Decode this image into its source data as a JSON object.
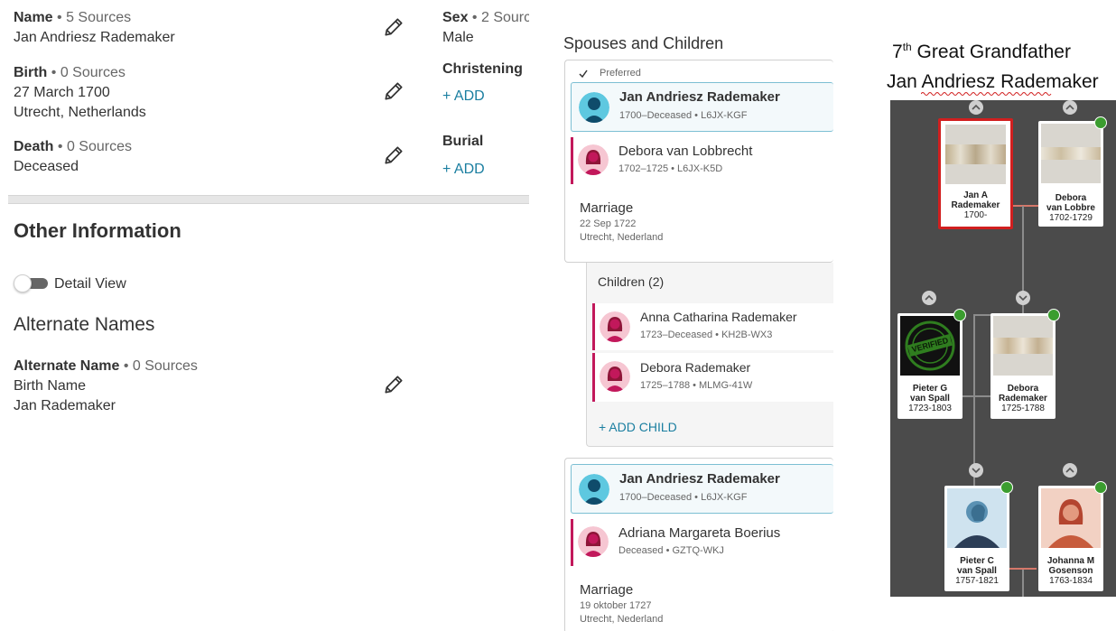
{
  "left": {
    "name": {
      "label": "Name",
      "sources": "• 5 Sources",
      "value": "Jan Andriesz Rademaker"
    },
    "birth": {
      "label": "Birth",
      "sources": "• 0 Sources",
      "date": "27 March 1700",
      "place": "Utrecht, Netherlands"
    },
    "death": {
      "label": "Death",
      "sources": "• 0 Sources",
      "value": "Deceased"
    },
    "sex": {
      "label": "Sex",
      "sources": "• 2 Sourc",
      "value": "Male"
    },
    "christening": {
      "label": "Christening",
      "add": "+ ADD"
    },
    "burial": {
      "label": "Burial",
      "add": "+ ADD"
    },
    "other_info_title": "Other Information",
    "detail_view": "Detail View",
    "alternate_names_title": "Alternate Names",
    "alt_name": {
      "label": "Alternate Name",
      "sources": "• 0 Sources",
      "type": "Birth Name",
      "value": "Jan Rademaker"
    }
  },
  "middle": {
    "title": "Spouses and Children",
    "preferred": "Preferred",
    "family1": {
      "husband": {
        "name": "Jan Andriesz Rademaker",
        "meta": "1700–Deceased • L6JX-KGF"
      },
      "wife": {
        "name": "Debora van Lobbrecht",
        "meta": "1702–1725 • L6JX-K5D"
      },
      "marriage_label": "Marriage",
      "marriage_date": "22 Sep 1722",
      "marriage_place": "Utrecht, Nederland",
      "children_label": "Children (2)",
      "children": [
        {
          "name": "Anna Catharina Rademaker",
          "meta": "1723–Deceased • KH2B-WX3"
        },
        {
          "name": "Debora Rademaker",
          "meta": "1725–1788 • MLMG-41W"
        }
      ],
      "add_child": "+ ADD CHILD"
    },
    "family2": {
      "husband": {
        "name": "Jan Andriesz Rademaker",
        "meta": "1700–Deceased • L6JX-KGF"
      },
      "wife": {
        "name": "Adriana Margareta Boerius",
        "meta": "Deceased • GZTQ-WKJ"
      },
      "marriage_label": "Marriage",
      "marriage_date": "19 oktober 1727",
      "marriage_place": "Utrecht, Nederland"
    }
  },
  "right": {
    "heading_prefix": "7",
    "heading_sup": "th",
    "heading_rest": " Great Grandfather",
    "heading_name": "Jan Andriesz Rademaker",
    "verified_text": "VERIFIED",
    "cards": [
      {
        "name1": "Jan A",
        "name2": "Rademaker",
        "dates": "1700-"
      },
      {
        "name1": "Debora",
        "name2": "van Lobbre",
        "dates": "1702-1729"
      },
      {
        "name1": "Pieter G",
        "name2": "van Spall",
        "dates": "1723-1803"
      },
      {
        "name1": "Debora",
        "name2": "Rademaker",
        "dates": "1725-1788"
      },
      {
        "name1": "Pieter C",
        "name2": "van Spall",
        "dates": "1757-1821"
      },
      {
        "name1": "Johanna M",
        "name2": "Gosenson",
        "dates": "1763-1834"
      }
    ]
  },
  "colors": {
    "accent": "#1a7ea0",
    "female": "#c2185b",
    "male_avatar": "#5ec8e0",
    "tree_bg": "#4b4b4b",
    "highlight_red": "#d11f1f",
    "badge_green": "#3b9d2f"
  }
}
